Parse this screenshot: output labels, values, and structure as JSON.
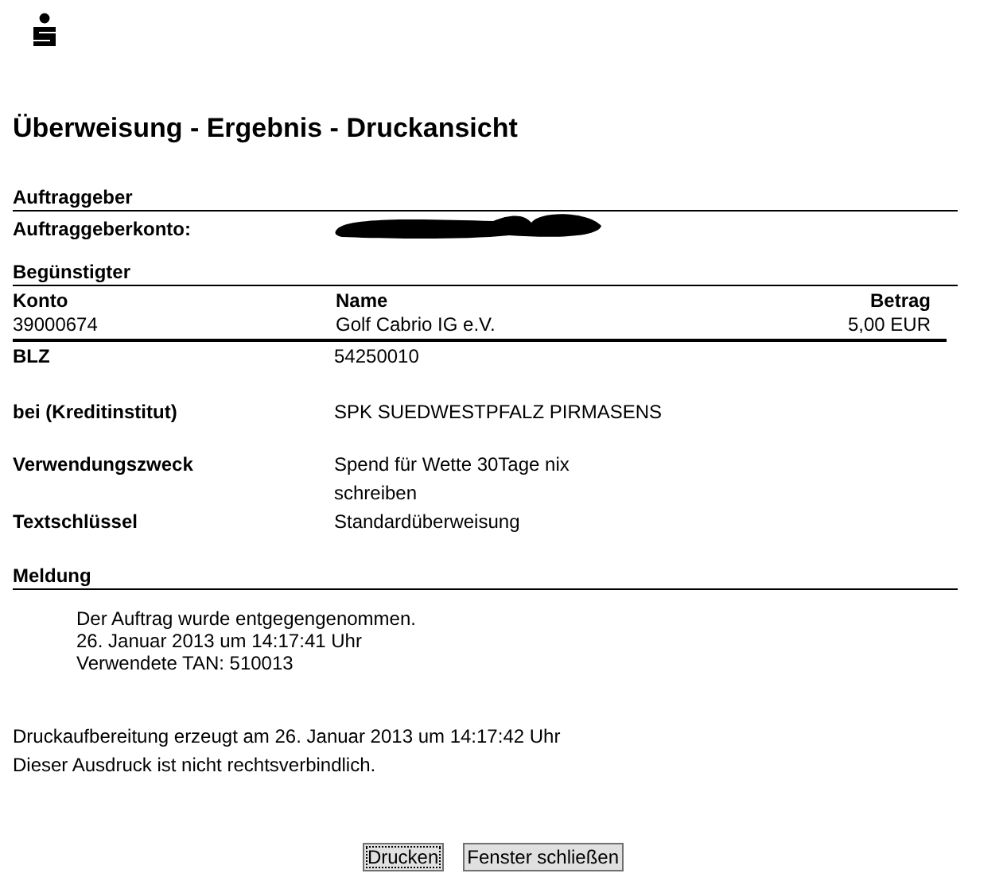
{
  "title": "Überweisung - Ergebnis - Druckansicht",
  "auftraggeber": {
    "heading": "Auftraggeber",
    "konto_label": "Auftraggeberkonto:",
    "konto_redacted": true
  },
  "beguenstigter": {
    "heading": "Begünstigter",
    "columns": [
      "Konto",
      "Name",
      "Betrag"
    ],
    "row": [
      "39000674",
      "Golf Cabrio IG e.V.",
      "5,00 EUR"
    ],
    "details": [
      {
        "label": "BLZ",
        "lines": [
          "54250010"
        ]
      },
      {
        "label": "bei (Kreditinstitut)",
        "lines": [
          "SPK SUEDWESTPFALZ PIRMASENS"
        ]
      },
      {
        "label": "Verwendungszweck",
        "lines": [
          "Spend für Wette 30Tage nix",
          "schreiben"
        ]
      },
      {
        "label": "Textschlüssel",
        "lines": [
          "Standardüberweisung"
        ]
      }
    ]
  },
  "meldung": {
    "heading": "Meldung",
    "lines": [
      "Der Auftrag wurde entgegengenommen.",
      "26. Januar 2013 um 14:17:41 Uhr",
      "Verwendete TAN: 510013"
    ]
  },
  "footer": [
    "Druckaufbereitung erzeugt am 26. Januar 2013 um 14:17:42 Uhr",
    "Dieser Ausdruck ist nicht rechtsverbindlich."
  ],
  "buttons": [
    {
      "label": "Drucken",
      "focused": true
    },
    {
      "label": "Fenster schließen",
      "focused": false
    }
  ]
}
